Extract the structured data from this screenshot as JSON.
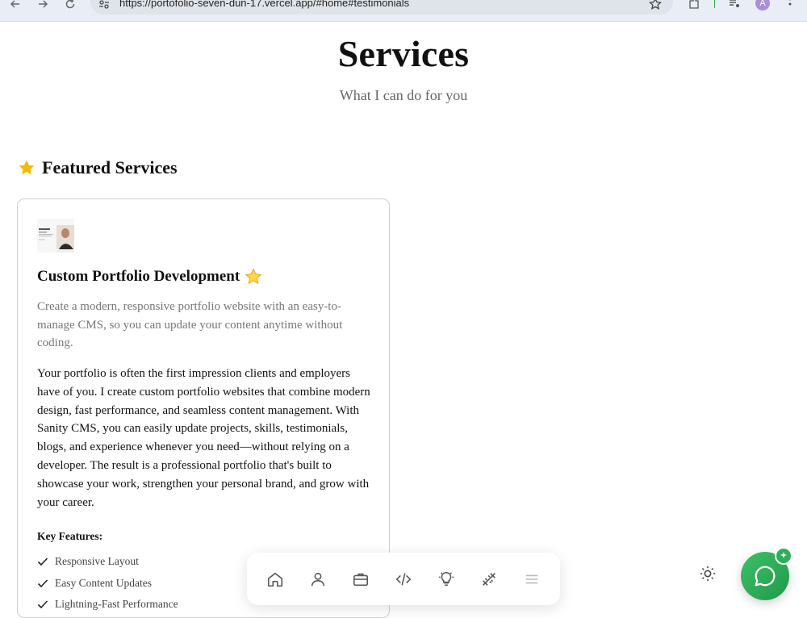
{
  "browser": {
    "url": "https://portofolio-seven-dun-17.vercel.app/#home#testimonials",
    "profile_initial": "A"
  },
  "page": {
    "title": "Services",
    "subtitle": "What I can do for you"
  },
  "featured": {
    "heading": "Featured Services",
    "icon": "star-icon",
    "accent": "#f5b800"
  },
  "service_card": {
    "title": "Custom Portfolio Development",
    "short_description": "Create a modern, responsive portfolio website with an easy-to-manage CMS, so you can update your content anytime without coding.",
    "body": "Your portfolio is often the first impression clients and employers have of you. I create custom portfolio websites that combine modern design, fast performance, and seamless content management. With Sanity CMS, you can easily update projects, skills, testimonials, blogs, and experience whenever you need—without relying on a developer. The result is a professional portfolio that's built to showcase your work, strengthen your personal brand, and grow with your career.",
    "features_heading": "Key Features:",
    "features": [
      "Responsive Layout",
      "Easy Content Updates",
      "Lightning-Fast Performance"
    ]
  },
  "dock": {
    "items": [
      "home-icon",
      "user-icon",
      "briefcase-icon",
      "code-icon",
      "lightbulb-icon",
      "tools-icon",
      "menu-icon"
    ]
  },
  "colors": {
    "chat_green": "#2fae5a",
    "text_muted": "#777777"
  }
}
